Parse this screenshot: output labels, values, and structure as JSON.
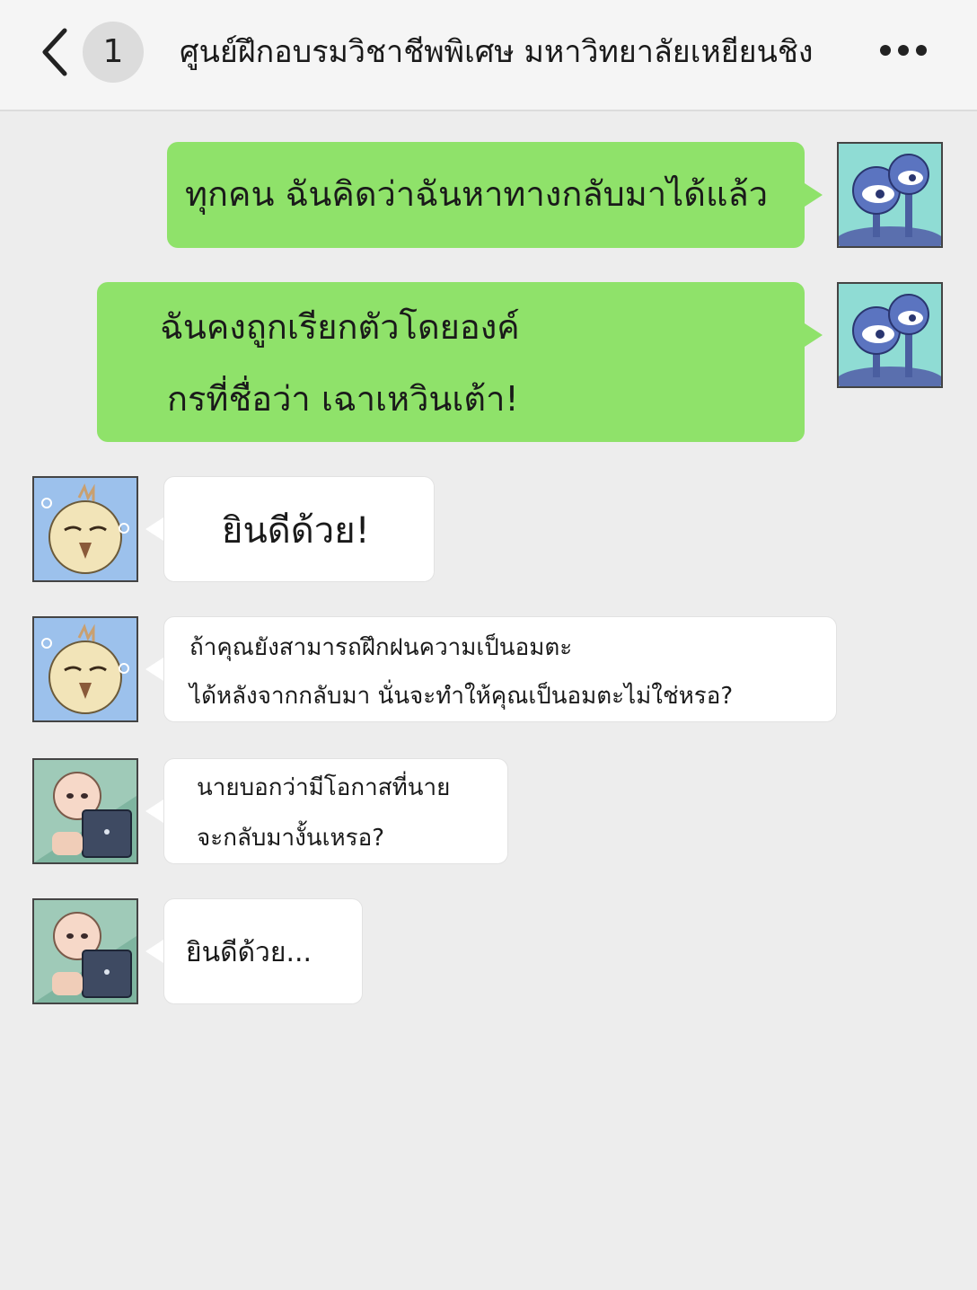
{
  "header": {
    "back_icon": "chevron-left-icon",
    "unread_count": "1",
    "title": "ศูนย์ฝึกอบรมวิชาชีพพิเศษ มหาวิทยาลัยเหยียนชิง",
    "more_icon": "more-dots-icon"
  },
  "messages": [
    {
      "side": "right",
      "avatar": "twin-blue-creatures-avatar",
      "lines": [
        "ทุกคน ฉันคิดว่าฉันหาทางกลับมาได้แล้ว"
      ]
    },
    {
      "side": "right",
      "avatar": "twin-blue-creatures-avatar",
      "lines": [
        "ฉันคงถูกเรียกตัวโดยองค์",
        "กรที่ชื่อว่า เฉาเหวินเต้า!"
      ]
    },
    {
      "side": "left",
      "avatar": "sleepy-bird-avatar",
      "lines": [
        "ยินดีด้วย!"
      ]
    },
    {
      "side": "left",
      "avatar": "sleepy-bird-avatar",
      "lines": [
        "ถ้าคุณยังสามารถฝึกฝนความเป็นอมตะ",
        "ได้หลังจากกลับมา นั่นจะทำให้คุณเป็นอมตะไม่ใช่หรอ?"
      ]
    },
    {
      "side": "left",
      "avatar": "baby-laptop-avatar",
      "lines": [
        "นายบอกว่ามีโอกาสที่นาย",
        "จะกลับมางั้นเหรอ?"
      ]
    },
    {
      "side": "left",
      "avatar": "baby-laptop-avatar",
      "lines": [
        "ยินดีด้วย..."
      ]
    }
  ],
  "colors": {
    "background": "#ededed",
    "header": "#f5f5f5",
    "bubble_self": "#8fe26a",
    "bubble_other": "#ffffff"
  }
}
